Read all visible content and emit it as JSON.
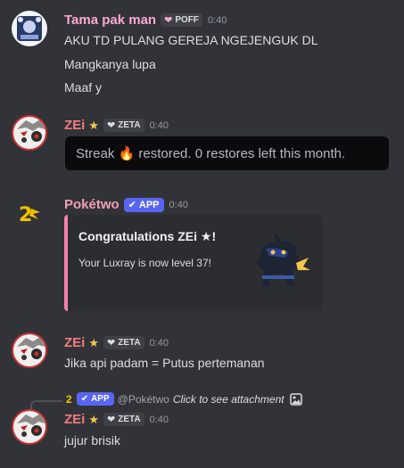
{
  "colors": {
    "background": "#323339",
    "tama_name": "#f9a8d4",
    "zei_name": "#f47c7c",
    "poketwo_name": "#f0a0b0",
    "app_badge": "#5865f2",
    "embed_accent": "#f47fac"
  },
  "messages": [
    {
      "author": "Tama pak man",
      "tag": "POFF",
      "time": "0:40",
      "lines": [
        "AKU TD PULANG GEREJA NGEJENGUK DL",
        "Mangkanya lupa",
        "Maaf y"
      ]
    },
    {
      "author": "ZEi",
      "star": "★",
      "tag": "ZETA",
      "time": "0:40",
      "streak_text": "Streak 🔥 restored. 0 restores left this month."
    },
    {
      "author": "Pokétwo",
      "app_badge": "APP",
      "time": "0:40",
      "embed": {
        "title": "Congratulations ZEi ★!",
        "description": "Your Luxray is now level 37!"
      }
    },
    {
      "author": "ZEi",
      "star": "★",
      "tag": "ZETA",
      "time": "0:40",
      "lines": [
        "Jika api padam = Putus pertemanan"
      ]
    },
    {
      "reply": {
        "badge": "APP",
        "mention": "@Pokétwo",
        "hint": "Click to see attachment"
      },
      "author": "ZEi",
      "star": "★",
      "tag": "ZETA",
      "time": "0:40",
      "lines": [
        "jujur brisik"
      ]
    }
  ]
}
